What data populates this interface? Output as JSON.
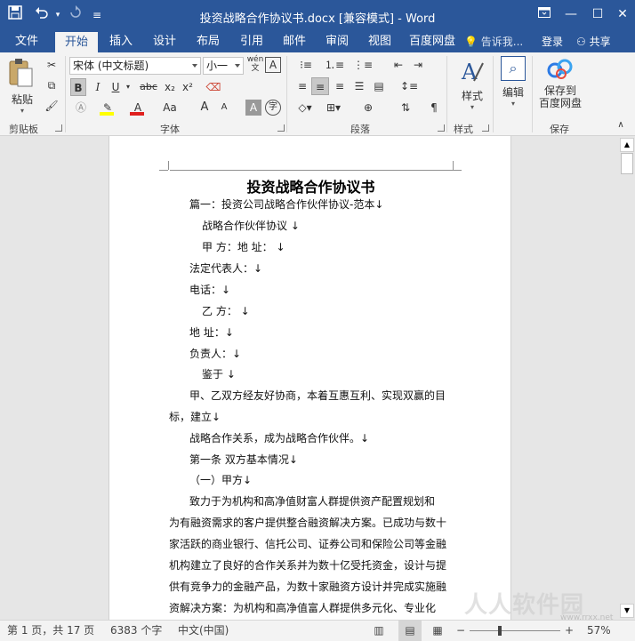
{
  "window": {
    "title": "投资战略合作协议书.docx [兼容模式] - Word",
    "controls": {
      "ribbon_options": "▭",
      "minimize": "—",
      "maximize": "☐",
      "close": "✕"
    }
  },
  "quick_access": {
    "save_icon": "save-icon",
    "undo_icon": "undo-icon",
    "redo_icon": "redo-icon",
    "customize_icon": "customize-icon"
  },
  "tabs": [
    {
      "label": "文件"
    },
    {
      "label": "开始"
    },
    {
      "label": "插入"
    },
    {
      "label": "设计"
    },
    {
      "label": "布局"
    },
    {
      "label": "引用"
    },
    {
      "label": "邮件"
    },
    {
      "label": "审阅"
    },
    {
      "label": "视图"
    },
    {
      "label": "百度网盘"
    }
  ],
  "tell_me": "告诉我...",
  "sign_in": "登录",
  "share": "共享",
  "ribbon": {
    "clipboard": {
      "paste_label": "粘贴",
      "group_label": "剪贴板"
    },
    "font": {
      "font_name": "宋体 (中文标题)",
      "font_size": "小一",
      "group_label": "字体",
      "bold": "B",
      "italic": "I",
      "underline": "U",
      "strike": "abc",
      "subscript": "x₂",
      "superscript": "x²",
      "grow": "A",
      "shrink": "A",
      "change_case": "Aa",
      "char_border": "A",
      "enclosed": "字",
      "phonetic": "wén"
    },
    "paragraph": {
      "group_label": "段落"
    },
    "styles": {
      "label": "样式",
      "group_label": "样式"
    },
    "editing": {
      "label": "编辑"
    },
    "save": {
      "label_line1": "保存到",
      "label_line2": "百度网盘",
      "group_label": "保存"
    }
  },
  "document": {
    "title": "投资战略合作协议书",
    "lines": [
      "篇一：投资公司战略合作伙伴协议-范本↓",
      "战略合作伙伴协议 ↓",
      "甲 方：地 址：  ↓",
      "法定代表人：↓",
      "电话：↓",
      "乙 方：  ↓",
      "地 址：↓",
      "负责人：↓",
      "鉴于 ↓",
      "甲、乙双方经友好协商，本着互惠互利、实现双赢的目",
      "标，建立↓",
      "战略合作关系，成为战略合作伙伴。↓",
      "第一条 双方基本情况↓",
      "（一）甲方↓",
      "致力于为机构和高净值财富人群提供资产配置规划和",
      "为有融资需求的客户提供整合融资解决方案。已成功与数十",
      "家活跃的商业银行、信托公司、证券公司和保险公司等金融",
      "机构建立了良好的合作关系并为数十亿受托资金，设计与提",
      "供有竞争力的金融产品，为数十家融资方设计并完成实施融",
      "资解决方案：为机构和高净值富人群提供多元化、专业化"
    ]
  },
  "status": {
    "page": "第 1 页，共 17 页",
    "words": "6383 个字",
    "language": "中文(中国)",
    "zoom": "57%"
  },
  "watermark": "人人软件园",
  "watermark_url": "www.rrxx.net"
}
